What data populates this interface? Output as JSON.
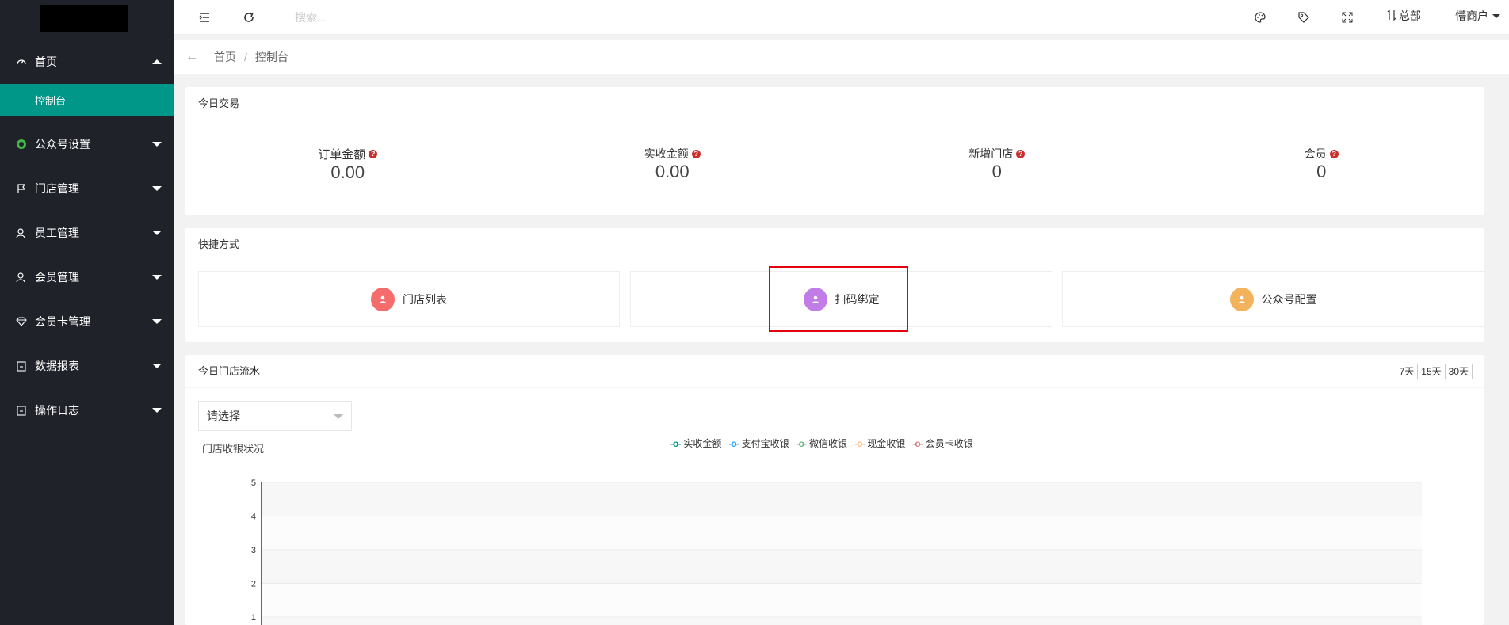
{
  "header": {
    "search_placeholder": "搜索...",
    "branch_label": "总部",
    "user_label": "懵商户"
  },
  "breadcrumb": {
    "items": [
      "首页",
      "控制台"
    ]
  },
  "sidebar": {
    "items": [
      {
        "label": "首页",
        "icon": "gauge-icon",
        "expanded": true
      },
      {
        "label": "公众号设置",
        "icon": "wechat-icon"
      },
      {
        "label": "门店管理",
        "icon": "flag-icon"
      },
      {
        "label": "员工管理",
        "icon": "user-icon"
      },
      {
        "label": "会员管理",
        "icon": "user-icon"
      },
      {
        "label": "会员卡管理",
        "icon": "diamond-icon"
      },
      {
        "label": "数据报表",
        "icon": "clipboard-icon"
      },
      {
        "label": "操作日志",
        "icon": "clipboard-icon"
      }
    ],
    "active_sub": "控制台"
  },
  "today": {
    "title": "今日交易",
    "stats": [
      {
        "label": "订单金额",
        "value": "0.00"
      },
      {
        "label": "实收金额",
        "value": "0.00"
      },
      {
        "label": "新增门店",
        "value": "0"
      },
      {
        "label": "会员",
        "value": "0"
      }
    ]
  },
  "shortcuts": {
    "title": "快捷方式",
    "items": [
      {
        "label": "门店列表",
        "color": "#f56c6c"
      },
      {
        "label": "扫码绑定",
        "color": "#c27ce8"
      },
      {
        "label": "公众号配置",
        "color": "#f3b35c"
      }
    ]
  },
  "flow": {
    "title": "今日门店流水",
    "ranges": [
      "7天",
      "15天",
      "30天"
    ],
    "select_placeholder": "请选择"
  },
  "chart_data": {
    "type": "line",
    "title": "门店收银状况",
    "series": [
      {
        "name": "实收金额",
        "color": "#009688",
        "values": []
      },
      {
        "name": "支付宝收银",
        "color": "#1e9fff",
        "values": []
      },
      {
        "name": "微信收银",
        "color": "#5fb878",
        "values": []
      },
      {
        "name": "现金收银",
        "color": "#ffb980",
        "values": []
      },
      {
        "name": "会员卡收银",
        "color": "#d87a80",
        "values": []
      }
    ],
    "y_ticks": [
      "5",
      "4",
      "3",
      "2",
      "1"
    ],
    "ylim": [
      0,
      5
    ],
    "grid": true
  }
}
